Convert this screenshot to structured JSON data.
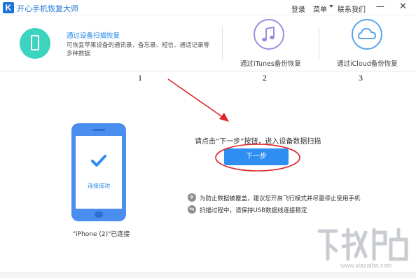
{
  "titlebar": {
    "logo_letter": "K",
    "app_title": "开心手机恢复大师",
    "login": "登录",
    "menu": "菜单",
    "contact": "联系我们",
    "minimize": "—",
    "close": "✕"
  },
  "modes": {
    "device_scan": {
      "title": "通过设备扫描恢复",
      "description": "可恢复苹果设备的通讯录、备忘录、短信、通话记录等多种数据",
      "icon": "phone-icon"
    },
    "itunes": {
      "label": "通过iTunes备份恢复",
      "icon": "music-note-icon"
    },
    "icloud": {
      "label": "通过iCloud备份恢复",
      "icon": "cloud-icon"
    }
  },
  "step_numbers": [
    "1",
    "2",
    "3"
  ],
  "device": {
    "connected_text": "连接成功",
    "name": "\"iPhone (2)\"已连接"
  },
  "instruction": "请点击“下一步”按钮，进入设备数据扫描",
  "next_button": "下一步",
  "tips": [
    "为防止数据被覆盖，建议您开启飞行模式并尽量停止使用手机",
    "扫描过程中，请保持USB数据线连接稳定"
  ],
  "watermark": {
    "text": "www.xiazaiba.com"
  },
  "colors": {
    "accent_blue": "#2f8ef1",
    "teal": "#3cd3bf",
    "purple": "#a18be0",
    "annotation_red": "#e0262b"
  }
}
